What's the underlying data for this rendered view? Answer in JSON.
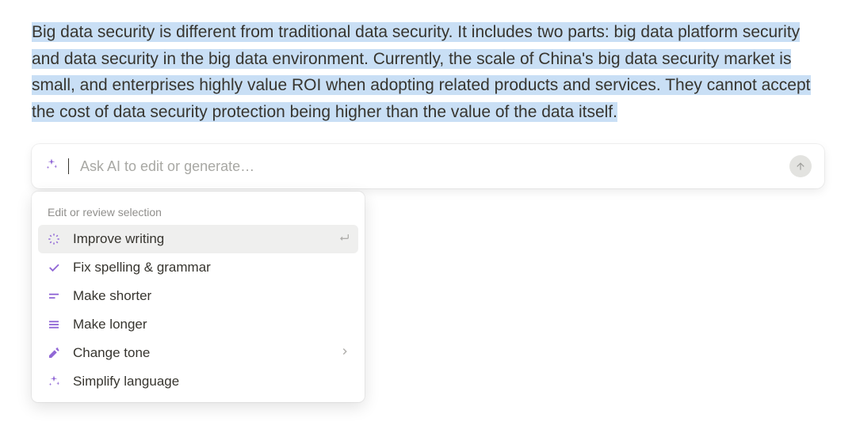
{
  "selected_text": "Big data security is different from traditional data security. It includes two parts: big data platform security and data security in the big data environment. Currently, the scale of China's big data security market is small, and enterprises highly value ROI when adopting related products and services. They cannot accept the cost of data security protection being higher than the value of the data itself.",
  "ai_input": {
    "placeholder": "Ask AI to edit or generate…",
    "value": ""
  },
  "menu": {
    "header": "Edit or review selection",
    "items": [
      {
        "icon": "improve",
        "label": "Improve writing",
        "trailing": "enter",
        "hovered": true
      },
      {
        "icon": "check",
        "label": "Fix spelling & grammar",
        "trailing": null,
        "hovered": false
      },
      {
        "icon": "shorter",
        "label": "Make shorter",
        "trailing": null,
        "hovered": false
      },
      {
        "icon": "longer",
        "label": "Make longer",
        "trailing": null,
        "hovered": false
      },
      {
        "icon": "tone",
        "label": "Change tone",
        "trailing": "chevron",
        "hovered": false
      },
      {
        "icon": "sparkle",
        "label": "Simplify language",
        "trailing": null,
        "hovered": false
      }
    ]
  },
  "colors": {
    "accent": "#9168d6",
    "highlight": "#c9dff5",
    "text": "#37352f"
  }
}
